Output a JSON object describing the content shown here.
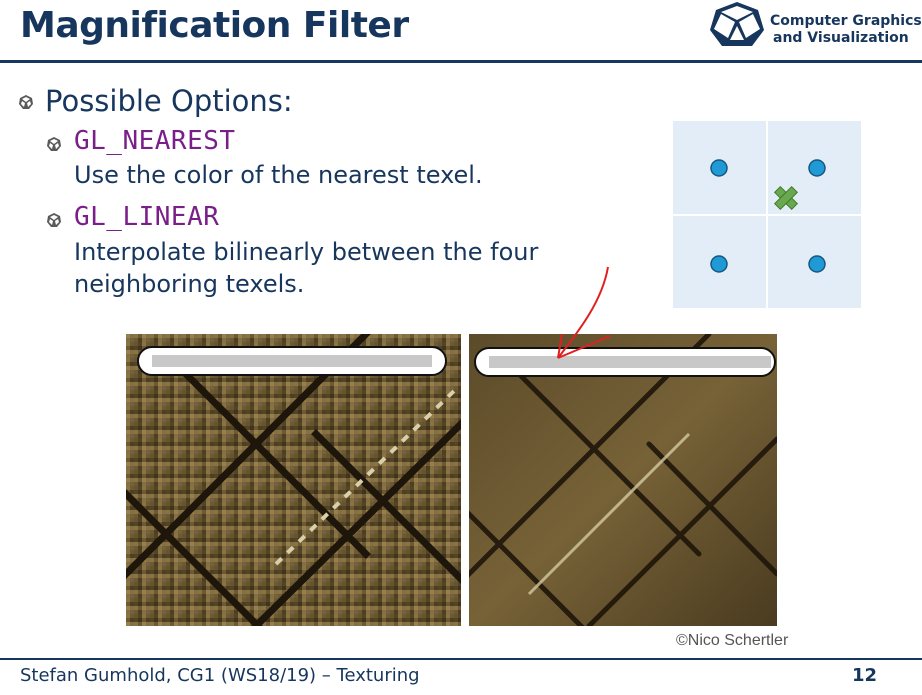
{
  "slide": {
    "title": "Magnification Filter",
    "logo_line1": "Computer Graphics",
    "logo_line2": "and Visualization",
    "heading": "Possible Options:",
    "options": [
      {
        "name": "GL_NEAREST",
        "desc_line1": "Use the color of the nearest texel.",
        "desc_line2": ""
      },
      {
        "name": "GL_LINEAR",
        "desc_line1": "Interpolate bilinearly between the four",
        "desc_line2": "neighboring texels."
      }
    ],
    "credit": "©Nico Schertler",
    "footer": "Stefan Gumhold, CG1 (WS18/19) – Texturing",
    "page_number": "12"
  },
  "colors": {
    "title": "#17365d",
    "option_name": "#7a1f8a",
    "texel_dot": "#1f9ad6",
    "sample_marker": "#6aa84f",
    "diagram_bg": "#e3edf8",
    "annotation_arrow": "#e02020"
  },
  "icons": {
    "bullet": "polyhedron-bullet-icon",
    "logo": "polyhedron-logo-icon",
    "sample": "cross-marker-icon"
  }
}
